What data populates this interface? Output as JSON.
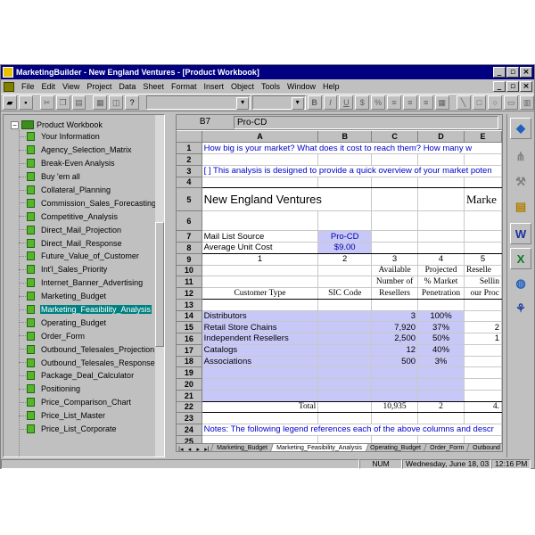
{
  "window": {
    "title": "MarketingBuilder - New England Ventures - [Product Workbook]",
    "controls": [
      "_",
      "▫",
      "×"
    ]
  },
  "menu": [
    "File",
    "Edit",
    "View",
    "Project",
    "Data",
    "Sheet",
    "Format",
    "Insert",
    "Object",
    "Tools",
    "Window",
    "Help"
  ],
  "tree": {
    "root": "Product Workbook",
    "selected_index": 13,
    "items": [
      "Your Information",
      "Agency_Selection_Matrix",
      "Break-Even Analysis",
      "Buy 'em all",
      "Collateral_Planning",
      "Commission_Sales_Forecasting",
      "Competitive_Analysis",
      "Direct_Mail_Projection",
      "Direct_Mail_Response",
      "Future_Value_of_Customer",
      "Int'l_Sales_Priority",
      "Internet_Banner_Advertising",
      "Marketing_Budget",
      "Marketing_Feasibility_Analysis",
      "Operating_Budget",
      "Order_Form",
      "Outbound_Telesales_Projection",
      "Outbound_Telesales_Response",
      "Package_Deal_Calculator",
      "Positioning",
      "Price_Comparison_Chart",
      "Price_List_Master",
      "Price_List_Corporate"
    ]
  },
  "sheet": {
    "cell_ref": "B7",
    "formula": "Pro-CD",
    "columns": [
      "A",
      "B",
      "C",
      "D",
      "E"
    ],
    "row_numbers": [
      "1",
      "2",
      "3",
      "4",
      "5",
      "6",
      "7",
      "8",
      "9",
      "10",
      "11",
      "12",
      "13",
      "14",
      "15",
      "16",
      "17",
      "18",
      "19",
      "20",
      "21",
      "22",
      "23",
      "24",
      "25"
    ],
    "r1": "How big is your market? What does it cost to reach them? How many w",
    "r3": "[ ]  This analysis is designed to provide a quick overview of your market poten",
    "company": "New England Ventures",
    "marke": "Marke",
    "mail_list_label": "Mail List Source",
    "mail_list_value": "Pro-CD",
    "avg_cost_label": "Average Unit Cost",
    "avg_cost_value": "$9.00",
    "colnums": [
      "1",
      "2",
      "3",
      "4",
      "5"
    ],
    "hdr": {
      "c_available": "Available",
      "c_number_of": "Number of",
      "c_resellers": "Resellers",
      "d_projected": "Projected",
      "d_pct_market": "% Market",
      "d_penetration": "Penetration",
      "e_reselle": "Reselle",
      "e_sellin": "Sellin",
      "e_our_proc": "our Proc",
      "a_customer_type": "Customer Type",
      "b_sic_code": "SIC Code"
    },
    "rows": [
      {
        "type": "Distributors",
        "c": "3",
        "d": "100%",
        "e": ""
      },
      {
        "type": "Retail Store Chains",
        "c": "7,920",
        "d": "37%",
        "e": "2"
      },
      {
        "type": "Independent Resellers",
        "c": "2,500",
        "d": "50%",
        "e": "1"
      },
      {
        "type": "Catalogs",
        "c": "12",
        "d": "40%",
        "e": ""
      },
      {
        "type": "Associations",
        "c": "500",
        "d": "3%",
        "e": ""
      }
    ],
    "total_label": "Total",
    "total_c": "10,935",
    "total_d": "2",
    "total_e": "4.",
    "notes": "Notes:  The following legend references each of the above columns and descr",
    "tabs": [
      "Marketing_Budget",
      "Marketing_Feasibility_Analysis",
      "Operating_Budget",
      "Order_Form",
      "Outbound"
    ],
    "active_tab": 1
  },
  "statusbar": {
    "mode": "NUM",
    "date": "Wednesday, June 18, 03",
    "time": "12:16 PM"
  },
  "rightbar": [
    "nav-up-icon",
    "tree-icon",
    "tools-icon",
    "clipboard-icon",
    "word-icon",
    "excel-icon",
    "globe-icon",
    "web-icon"
  ]
}
